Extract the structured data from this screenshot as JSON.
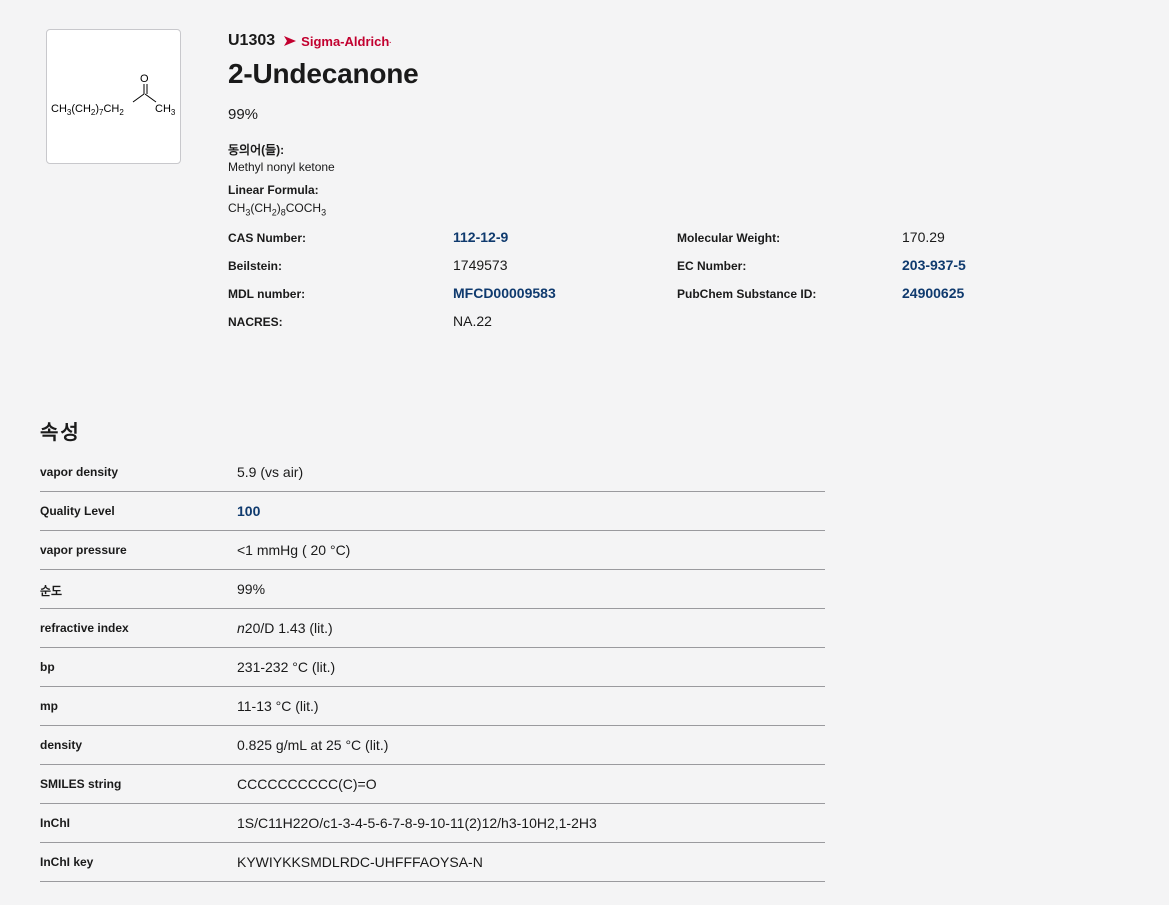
{
  "structure": {
    "left_formula": "CH3(CH2)7CH2",
    "oxygen": "O",
    "right_formula": "CH3"
  },
  "product": {
    "sku": "U1303",
    "brand": "Sigma-Aldrich",
    "brand_reg": ".",
    "brand_color": "#c2002f",
    "title": "2-Undecanone",
    "purity": "99%",
    "synonyms_label": "동의어(들):",
    "synonyms_value": "Methyl nonyl ketone",
    "linear_formula_label": "Linear Formula:",
    "linear_formula_parts": [
      "CH",
      "3",
      "(CH",
      "2",
      ")",
      "8",
      "COCH",
      "3"
    ]
  },
  "identifiers": [
    {
      "label": "CAS Number:",
      "value": "112-12-9",
      "link": true,
      "label2": "Molecular Weight:",
      "value2": "170.29",
      "link2": false
    },
    {
      "label": "Beilstein:",
      "value": "1749573",
      "link": false,
      "label2": "EC Number:",
      "value2": "203-937-5",
      "link2": true
    },
    {
      "label": "MDL number:",
      "value": "MFCD00009583",
      "link": true,
      "label2": "PubChem Substance ID:",
      "value2": "24900625",
      "link2": true
    },
    {
      "label": "NACRES:",
      "value": "NA.22",
      "link": false
    }
  ],
  "properties_title": "속성",
  "properties": [
    {
      "label": "vapor density",
      "value": "5.9 (vs air)"
    },
    {
      "label": "Quality Level",
      "value": "100",
      "link": true
    },
    {
      "label": "vapor pressure",
      "value": "<1 mmHg ( 20 °C)"
    },
    {
      "label": "순도",
      "value": "99%"
    },
    {
      "label": "refractive index",
      "value_italic": "n",
      "value": "20/D 1.43 (lit.)"
    },
    {
      "label": "bp",
      "value": "231-232 °C (lit.)"
    },
    {
      "label": "mp",
      "value": "11-13 °C (lit.)"
    },
    {
      "label": "density",
      "value": "0.825 g/mL at 25 °C (lit.)"
    },
    {
      "label": "SMILES string",
      "value": "CCCCCCCCCC(C)=O"
    },
    {
      "label": "InChI",
      "value": "1S/C11H22O/c1-3-4-5-6-7-8-9-10-11(2)12/h3-10H2,1-2H3"
    },
    {
      "label": "InChI key",
      "value": "KYWIYKKSMDLRDC-UHFFFAOYSA-N"
    }
  ]
}
